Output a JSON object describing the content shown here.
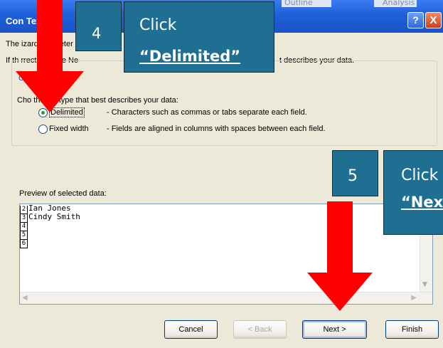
{
  "window": {
    "title_visible": "Con   Tex   ur",
    "help_label": "?",
    "close_label": "X",
    "background_strip": [
      "Outline",
      "Analysis"
    ]
  },
  "wizard": {
    "intro_line1": "The   izard has deter",
    "intro_line2": "If th   rrect, choose Ne",
    "intro_line2_tail": "t describes your data.",
    "group_label": "O   l   type",
    "choose_label": "Cho   the file type that best describes your data:",
    "options": [
      {
        "label": "Delimited",
        "desc": "- Characters such as commas or tabs separate each field.",
        "selected": true
      },
      {
        "label": "Fixed width",
        "desc": "- Fields are aligned in columns with spaces between each field.",
        "selected": false
      }
    ],
    "preview_label": "Preview of selected data:",
    "preview_rows": [
      {
        "n": "2",
        "text": "Ian Jones"
      },
      {
        "n": "3",
        "text": "Cindy Smith"
      },
      {
        "n": "4",
        "text": ""
      },
      {
        "n": "5",
        "text": ""
      },
      {
        "n": "6",
        "text": ""
      }
    ]
  },
  "buttons": {
    "cancel": "Cancel",
    "back": "< Back",
    "next": "Next >",
    "finish": "Finish"
  },
  "callouts": [
    {
      "step": "4",
      "line1": "Click",
      "line2": "“Delimited”"
    },
    {
      "step": "5",
      "line1": "Click",
      "line2": "“Nex"
    }
  ],
  "colors": {
    "callout_bg": "#1e6f91",
    "arrow": "#ff0000",
    "titlebar": "#1f5fd8"
  }
}
